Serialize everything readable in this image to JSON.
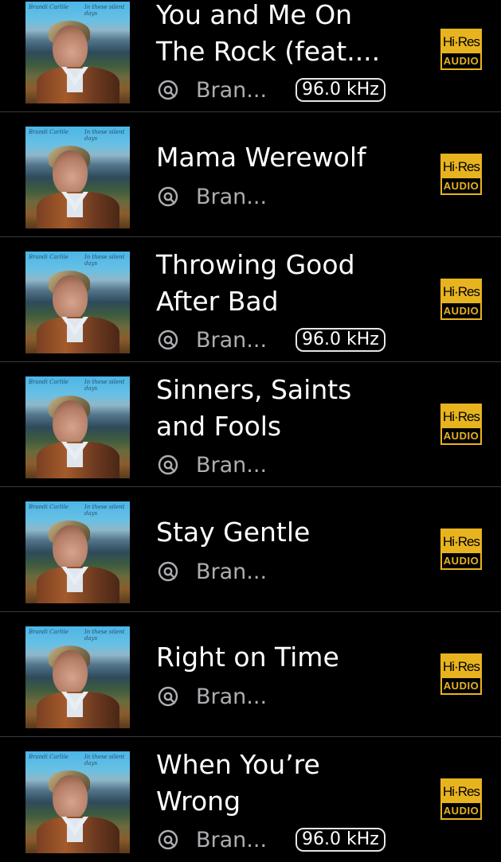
{
  "album": {
    "artist_script": "Brandi Carlile",
    "album_script": "In these silent days"
  },
  "badge": {
    "hires_top": "Hi·Res",
    "hires_bottom": "AUDIO"
  },
  "colors": {
    "hires_gold": "#e7b420",
    "secondary_text": "#aeaeb2",
    "divider": "#3a3a3c"
  },
  "tracks": [
    {
      "title": "You and Me On\nThe Rock (feat....",
      "artist": "Bran...",
      "khz": "96.0 kHz"
    },
    {
      "title": "Mama Werewolf",
      "artist": "Bran..."
    },
    {
      "title": "Throwing Good\nAfter Bad",
      "artist": "Bran...",
      "khz": "96.0 kHz"
    },
    {
      "title": "Sinners, Saints\nand Fools",
      "artist": "Bran..."
    },
    {
      "title": "Stay Gentle",
      "artist": "Bran..."
    },
    {
      "title": "Right on Time",
      "artist": "Bran..."
    },
    {
      "title": "When You’re\nWrong",
      "artist": "Bran...",
      "khz": "96.0 kHz"
    }
  ],
  "icons": {
    "artist_icon": "search-artist-icon",
    "badge_icon": "hi-res-audio-badge"
  }
}
